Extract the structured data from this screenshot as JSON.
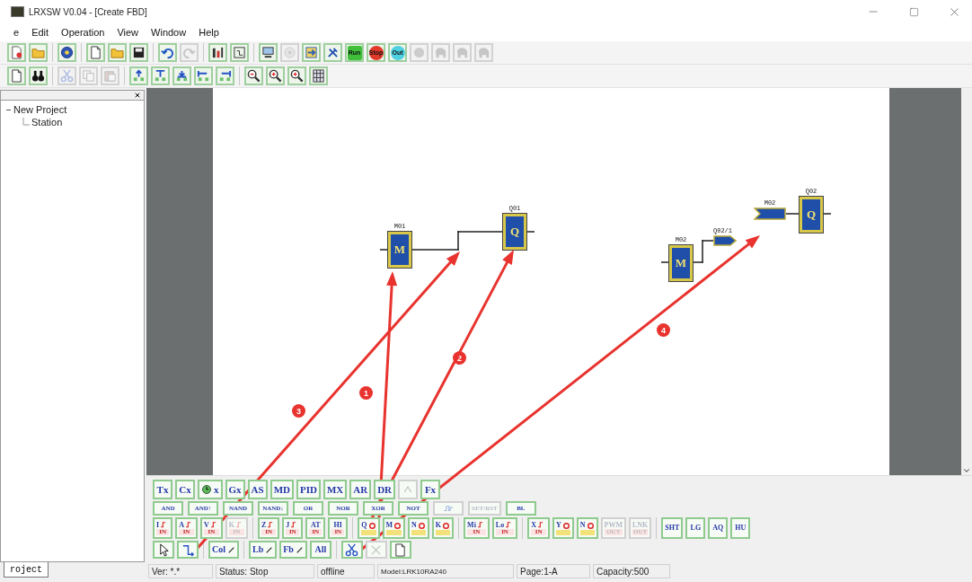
{
  "window": {
    "title": "LRXSW V0.04 - [Create FBD]"
  },
  "menu": [
    {
      "label": "e"
    },
    {
      "label": "Edit"
    },
    {
      "label": "Operation"
    },
    {
      "label": "View"
    },
    {
      "label": "Window"
    },
    {
      "label": "Help"
    }
  ],
  "toolbars": [
    {
      "groups": [
        [
          {
            "kind": "document",
            "disabled": false
          },
          {
            "kind": "folder",
            "disabled": false
          }
        ],
        [
          {
            "kind": "help",
            "disabled": false
          }
        ],
        [
          {
            "kind": "new",
            "disabled": false
          },
          {
            "kind": "open",
            "disabled": false
          },
          {
            "kind": "save",
            "disabled": false
          }
        ],
        [
          {
            "kind": "undo",
            "disabled": false
          },
          {
            "kind": "redo",
            "disabled": true
          }
        ],
        [
          {
            "kind": "chart",
            "disabled": false
          },
          {
            "kind": "frame",
            "disabled": false
          }
        ],
        [
          {
            "kind": "computer",
            "disabled": false
          },
          {
            "kind": "disc",
            "disabled": true
          },
          {
            "kind": "transfer",
            "disabled": false
          },
          {
            "kind": "tools",
            "disabled": false
          },
          {
            "kind": "run",
            "label": "Run",
            "disabled": false
          },
          {
            "kind": "stop",
            "label": "Stop",
            "disabled": false
          },
          {
            "kind": "out",
            "label": "Out",
            "disabled": false
          },
          {
            "kind": "circle",
            "disabled": true
          },
          {
            "kind": "figure",
            "disabled": true
          },
          {
            "kind": "figure",
            "disabled": true
          },
          {
            "kind": "figure",
            "disabled": true
          }
        ]
      ]
    },
    {
      "groups": [
        [
          {
            "kind": "new",
            "disabled": false
          },
          {
            "kind": "binoculars",
            "disabled": false
          }
        ],
        [
          {
            "kind": "cut",
            "disabled": true
          },
          {
            "kind": "copy",
            "disabled": true
          },
          {
            "kind": "paste",
            "disabled": true
          }
        ],
        [
          {
            "kind": "align-center",
            "disabled": false
          },
          {
            "kind": "align-top",
            "disabled": false
          },
          {
            "kind": "align-bottom",
            "disabled": false
          },
          {
            "kind": "align-left",
            "disabled": false
          },
          {
            "kind": "align-right",
            "disabled": false
          }
        ],
        [
          {
            "kind": "zoom-out",
            "disabled": false
          },
          {
            "kind": "zoom-in",
            "disabled": false
          },
          {
            "kind": "zoom-in",
            "disabled": false
          },
          {
            "kind": "grid",
            "disabled": false
          }
        ]
      ]
    }
  ],
  "project_tree": [
    {
      "label": "New Project",
      "expanded": true,
      "children": [
        {
          "label": "Station"
        }
      ]
    }
  ],
  "left_tab": {
    "label": "roject",
    "selected": true
  },
  "diagram": {
    "blocks": [
      {
        "kind": "block",
        "tag": "M01",
        "symbol": "M"
      },
      {
        "kind": "block",
        "tag": "Q01",
        "symbol": "Q"
      },
      {
        "kind": "block",
        "tag": "M02",
        "symbol": "M"
      },
      {
        "kind": "out-tag",
        "tag": "Q02/1"
      },
      {
        "kind": "in-flag",
        "tag": "M02"
      },
      {
        "kind": "block",
        "tag": "Q02",
        "symbol": "Q"
      }
    ]
  },
  "annotations": [
    {
      "number": "1"
    },
    {
      "number": "2"
    },
    {
      "number": "3"
    },
    {
      "number": "4"
    }
  ],
  "palette": {
    "rows": [
      {
        "groups": [
          [
            {
              "kind": "text",
              "label": "Tx",
              "disabled": false
            },
            {
              "kind": "text",
              "label": "Cx",
              "disabled": false
            },
            {
              "kind": "clock",
              "label": "x",
              "disabled": false
            },
            {
              "kind": "text",
              "label": "Gx",
              "disabled": false
            },
            {
              "kind": "text",
              "label": "AS",
              "disabled": false
            },
            {
              "kind": "text",
              "label": "MD",
              "disabled": false
            },
            {
              "kind": "text",
              "label": "PID",
              "disabled": false
            },
            {
              "kind": "text",
              "label": "MX",
              "disabled": false
            },
            {
              "kind": "text",
              "label": "AR",
              "disabled": false
            },
            {
              "kind": "text",
              "label": "DR",
              "disabled": false
            },
            {
              "kind": "blank",
              "disabled": true
            },
            {
              "kind": "text",
              "label": "Fx",
              "disabled": false
            }
          ]
        ]
      },
      {
        "groups": [
          [
            {
              "kind": "text",
              "label": "AND",
              "disabled": false
            },
            {
              "kind": "text",
              "label": "AND↑",
              "disabled": false
            },
            {
              "kind": "text",
              "label": "NAND",
              "disabled": false
            },
            {
              "kind": "text",
              "label": "NAND↓",
              "disabled": false
            },
            {
              "kind": "text",
              "label": "OR",
              "disabled": false
            },
            {
              "kind": "text",
              "label": "NOR",
              "disabled": false
            },
            {
              "kind": "text",
              "label": "XOR",
              "disabled": false
            },
            {
              "kind": "text",
              "label": "NOT",
              "disabled": false
            },
            {
              "kind": "pulse",
              "disabled": true
            },
            {
              "kind": "text",
              "label": "SET/RST",
              "disabled": true
            },
            {
              "kind": "text",
              "label": "BL",
              "disabled": false
            }
          ]
        ]
      },
      {
        "groups": [
          [
            {
              "kind": "input",
              "label": "I",
              "sub": "IN",
              "disabled": false
            },
            {
              "kind": "input",
              "label": "A",
              "sub": "IN",
              "disabled": false
            },
            {
              "kind": "input",
              "label": "V",
              "sub": "IN",
              "disabled": false
            },
            {
              "kind": "input",
              "label": "K",
              "sub": "IN",
              "disabled": true
            }
          ],
          [
            {
              "kind": "input",
              "label": "Z",
              "sub": "IN",
              "disabled": false
            },
            {
              "kind": "input",
              "label": "J",
              "sub": "IN",
              "disabled": false
            },
            {
              "kind": "two-line",
              "label": "AT",
              "sub": "IN",
              "disabled": false
            },
            {
              "kind": "two-line",
              "label": "HI",
              "sub": "IN",
              "disabled": false
            }
          ],
          [
            {
              "kind": "output",
              "label": "Q",
              "disabled": false
            },
            {
              "kind": "output",
              "label": "M",
              "disabled": false
            },
            {
              "kind": "output",
              "label": "N",
              "disabled": false
            },
            {
              "kind": "output",
              "label": "K",
              "disabled": false
            }
          ],
          [
            {
              "kind": "input",
              "label": "Mi",
              "sub": "IN",
              "disabled": false
            },
            {
              "kind": "input",
              "label": "Lo",
              "sub": "IN",
              "disabled": false
            }
          ],
          [
            {
              "kind": "input",
              "label": "X",
              "sub": "IN",
              "disabled": false
            },
            {
              "kind": "output",
              "label": "Y",
              "disabled": false
            },
            {
              "kind": "output",
              "label": "N",
              "disabled": false
            },
            {
              "kind": "two-line",
              "label": "PWM",
              "sub": "OUT",
              "disabled": true
            },
            {
              "kind": "two-line",
              "label": "LNK",
              "sub": "OUT",
              "disabled": true
            }
          ],
          [
            {
              "kind": "text",
              "label": "SHT",
              "disabled": false
            },
            {
              "kind": "text",
              "label": "LG",
              "disabled": false
            },
            {
              "kind": "text",
              "label": "AQ",
              "disabled": false
            },
            {
              "kind": "text",
              "label": "HU",
              "disabled": false
            }
          ]
        ]
      },
      {
        "groups": [
          [
            {
              "kind": "pointer",
              "disabled": false
            },
            {
              "kind": "connector",
              "disabled": false
            }
          ],
          [
            {
              "kind": "edit",
              "label": "Col",
              "disabled": false
            }
          ],
          [
            {
              "kind": "edit",
              "label": "Lb",
              "disabled": false
            },
            {
              "kind": "edit",
              "label": "Fb",
              "disabled": false
            },
            {
              "kind": "text",
              "label": "All",
              "disabled": false
            }
          ],
          [
            {
              "kind": "scissors",
              "disabled": false
            },
            {
              "kind": "delete",
              "disabled": true
            },
            {
              "kind": "page",
              "disabled": false
            }
          ]
        ]
      }
    ]
  },
  "status_bar": [
    {
      "text": "Ver: *.*"
    },
    {
      "text": "Status: Stop"
    },
    {
      "text": "offline"
    },
    {
      "text": "Model:LRK10RA240"
    },
    {
      "text": "Page:1-A"
    },
    {
      "text": "Capacity:500"
    }
  ]
}
